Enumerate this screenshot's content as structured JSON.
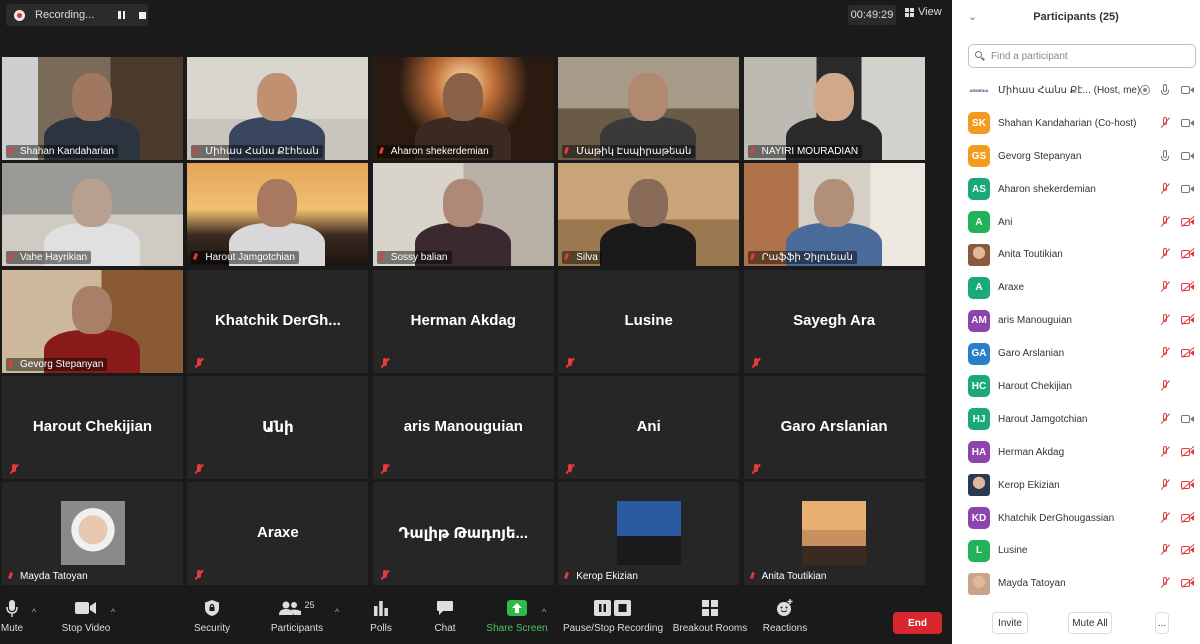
{
  "recording": {
    "label": "Recording..."
  },
  "timer": "00:49:29",
  "view_label": "View",
  "tiles": [
    {
      "name": "Shahan Kandaharian",
      "type": "video"
    },
    {
      "name": "Միհաս Հանս Քէհեան",
      "type": "video"
    },
    {
      "name": "Aharon shekerdemian",
      "type": "video"
    },
    {
      "name": "Մաթիկ Էսպիրաթեան",
      "type": "video"
    },
    {
      "name": "NAYIRI MOURADIAN",
      "type": "video"
    },
    {
      "name": "Vahe Hayrikian",
      "type": "video"
    },
    {
      "name": "Harout Jamgotchian",
      "type": "video"
    },
    {
      "name": "Sossy balian",
      "type": "video"
    },
    {
      "name": "Silva",
      "type": "video"
    },
    {
      "name": "Րաֆֆի Չիլուեան",
      "type": "video"
    },
    {
      "name": "Gevorg Stepanyan",
      "type": "video",
      "active": true
    },
    {
      "name": "Khatchik DerGh...",
      "type": "name"
    },
    {
      "name": "Herman Akdag",
      "type": "name"
    },
    {
      "name": "Lusine",
      "type": "name"
    },
    {
      "name": "Sayegh Ara",
      "type": "name"
    },
    {
      "name": "Harout Chekijian",
      "type": "name"
    },
    {
      "name": "Անի",
      "type": "name"
    },
    {
      "name": "aris Manouguian",
      "type": "name"
    },
    {
      "name": "Ani",
      "type": "name"
    },
    {
      "name": "Garo Arslanian",
      "type": "name"
    },
    {
      "name": "Mayda Tatoyan",
      "type": "photo"
    },
    {
      "name": "Araxe",
      "type": "name"
    },
    {
      "name": "Դալիթ Թադոյե...",
      "type": "name"
    },
    {
      "name": "Kerop Ekizian",
      "type": "photo"
    },
    {
      "name": "Anita Toutikian",
      "type": "photo"
    }
  ],
  "toolbar": {
    "mute": "Mute",
    "stop_video": "Stop Video",
    "security": "Security",
    "participants": "Participants",
    "participants_count": "25",
    "polls": "Polls",
    "chat": "Chat",
    "share_screen": "Share Screen",
    "recording": "Pause/Stop Recording",
    "breakout": "Breakout Rooms",
    "reactions": "Reactions",
    "end": "End"
  },
  "panel": {
    "title": "Participants (25)",
    "search_placeholder": "Find a participant",
    "participants": [
      {
        "initials": "",
        "name": "Միհաս Հանս Քէ...",
        "suffix": "(Host, me)",
        "color": "#ffffff",
        "mic": "on",
        "cam": "on",
        "rec": true,
        "logo": "ARMENIA"
      },
      {
        "initials": "SK",
        "name": "Shahan Kandaharian (Co-host)",
        "color": "#f39b1f",
        "mic": "off",
        "cam": "on"
      },
      {
        "initials": "GS",
        "name": "Gevorg Stepanyan",
        "color": "#f39b1f",
        "mic": "on",
        "cam": "on"
      },
      {
        "initials": "AS",
        "name": "Aharon shekerdemian",
        "color": "#1aa97b",
        "mic": "off",
        "cam": "on"
      },
      {
        "initials": "A",
        "name": "Ani",
        "color": "#20b35a",
        "mic": "off",
        "cam": "off"
      },
      {
        "initials": "",
        "name": "Anita Toutikian",
        "color": "#8a5a3c",
        "mic": "off",
        "cam": "off",
        "photo": true
      },
      {
        "initials": "A",
        "name": "Araxe",
        "color": "#1aa97b",
        "mic": "off",
        "cam": "off"
      },
      {
        "initials": "AM",
        "name": "aris Manouguian",
        "color": "#8e44ad",
        "mic": "off",
        "cam": "off"
      },
      {
        "initials": "GA",
        "name": "Garo Arslanian",
        "color": "#2980c9",
        "mic": "off",
        "cam": "off"
      },
      {
        "initials": "HC",
        "name": "Harout Chekijian",
        "color": "#1aa97b",
        "mic": "off",
        "cam": "none"
      },
      {
        "initials": "HJ",
        "name": "Harout Jamgotchian",
        "color": "#1aa97b",
        "mic": "off",
        "cam": "on"
      },
      {
        "initials": "HA",
        "name": "Herman Akdag",
        "color": "#8e44ad",
        "mic": "off",
        "cam": "off"
      },
      {
        "initials": "",
        "name": "Kerop Ekizian",
        "color": "#2a3a50",
        "mic": "off",
        "cam": "off",
        "photo": true
      },
      {
        "initials": "KD",
        "name": "Khatchik DerGhougassian",
        "color": "#8e44ad",
        "mic": "off",
        "cam": "off"
      },
      {
        "initials": "L",
        "name": "Lusine",
        "color": "#20b35a",
        "mic": "off",
        "cam": "off"
      },
      {
        "initials": "",
        "name": "Mayda Tatoyan",
        "color": "#c8a48a",
        "mic": "off",
        "cam": "off",
        "photo": true
      }
    ],
    "invite": "Invite",
    "mute_all": "Mute All",
    "more": "..."
  }
}
